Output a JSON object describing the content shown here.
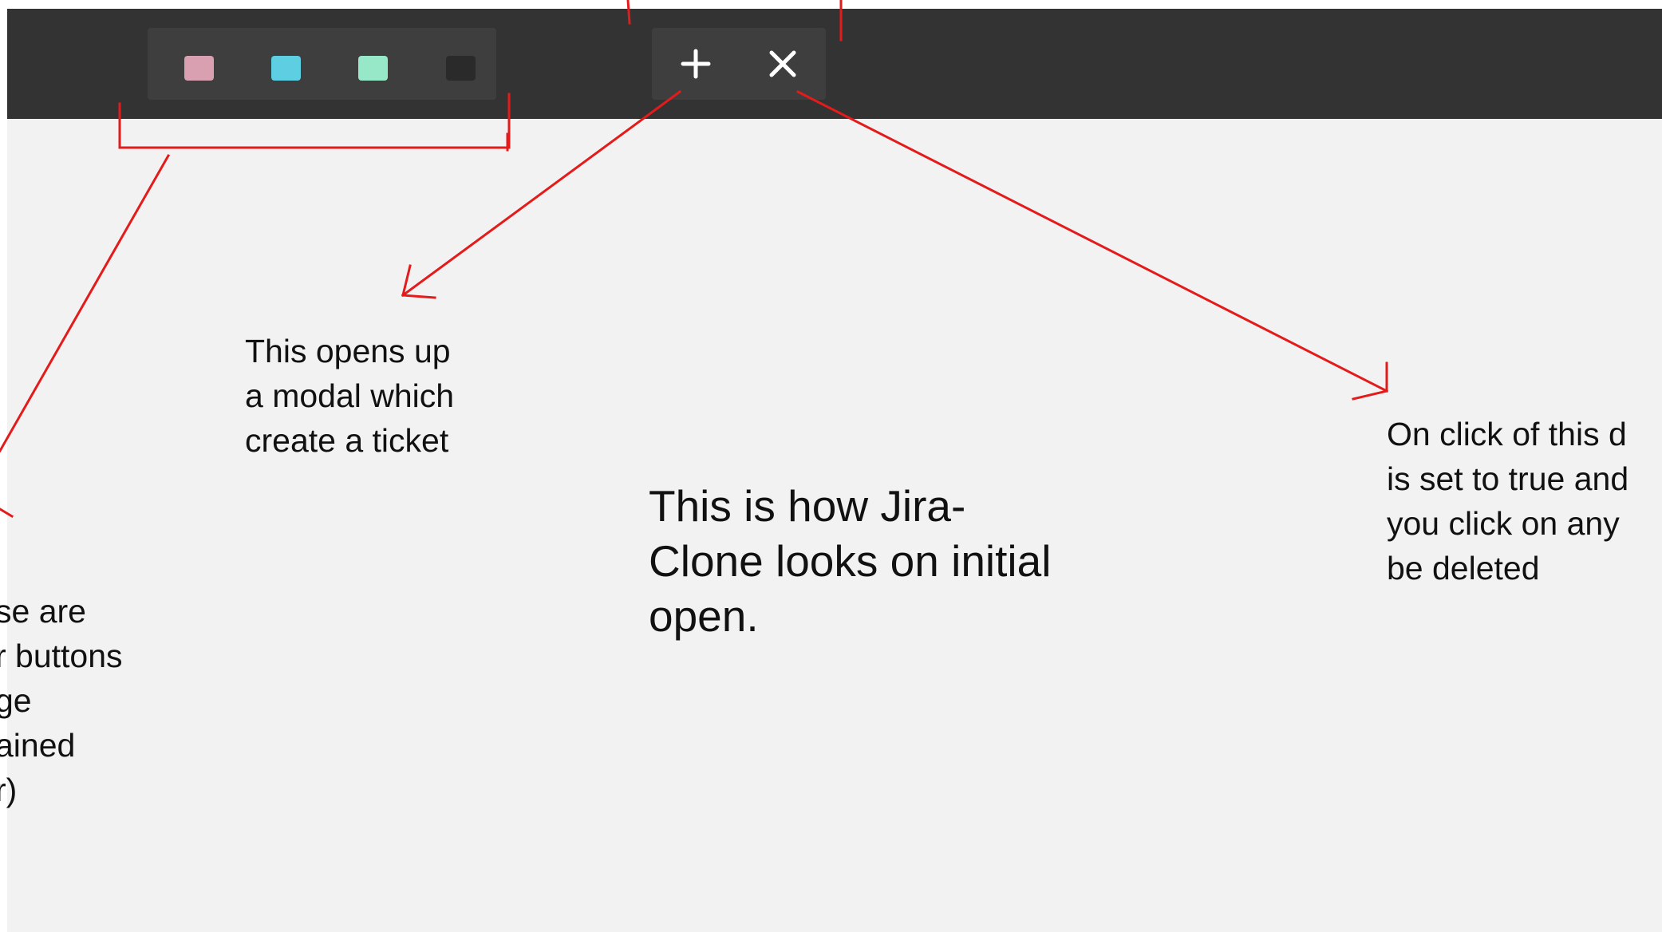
{
  "toolbar": {
    "color_buttons": [
      {
        "name": "pink",
        "color": "#d9a0b2"
      },
      {
        "name": "blue",
        "color": "#5ecfe3"
      },
      {
        "name": "green",
        "color": "#97e8c9"
      },
      {
        "name": "black",
        "color": "#2a2a2a"
      }
    ],
    "add_button_glyph": "+",
    "delete_button_glyph": "×"
  },
  "annotations": {
    "add_note": "This opens up\na modal which\ncreate a ticket",
    "main_note": "This is how Jira-\nClone looks on initial\nopen.",
    "delete_note": "On click of this d\nis set to true and\nyou click on any\nbe deleted",
    "color_note": "se are\nr buttons\nge\nained\nr)"
  },
  "colors": {
    "toolbar_bg": "#333333",
    "group_bg": "#3e3e3e",
    "canvas_bg": "#f2f2f2",
    "annotation_line": "#e31b1b"
  }
}
